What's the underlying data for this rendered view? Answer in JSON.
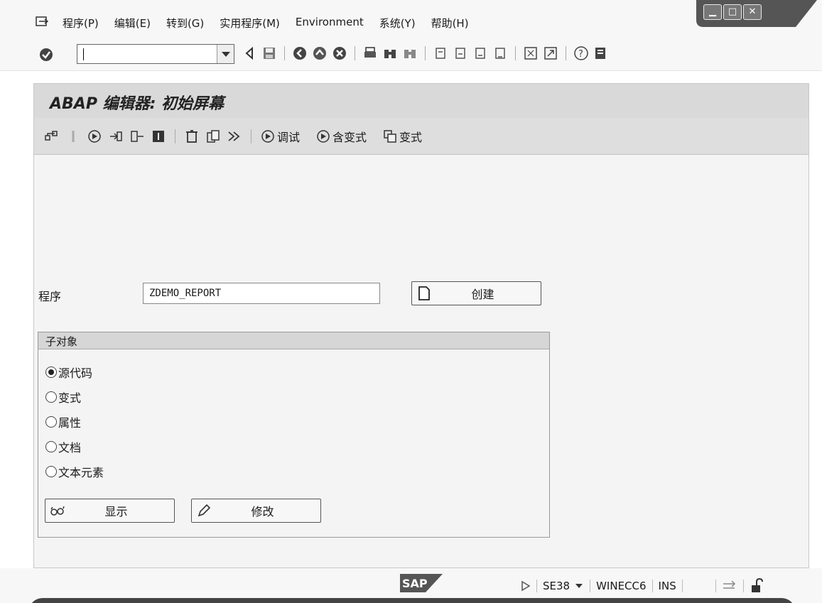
{
  "menubar": {
    "items": [
      {
        "label": "程序(P)"
      },
      {
        "label": "编辑(E)"
      },
      {
        "label": "转到(G)"
      },
      {
        "label": "实用程序(M)"
      },
      {
        "label": "Environment"
      },
      {
        "label": "系统(Y)"
      },
      {
        "label": "帮助(H)"
      }
    ]
  },
  "toolbar": {
    "command_value": ""
  },
  "screen": {
    "title": "ABAP 编辑器: 初始屏幕"
  },
  "app_toolbar": {
    "debug_label": "调试",
    "with_variant_label": "含变式",
    "variant_label": "变式"
  },
  "form": {
    "program_label": "程序",
    "program_value": "ZDEMO_REPORT",
    "create_label": "创建"
  },
  "subobjects": {
    "heading": "子对象",
    "options": [
      {
        "label": "源代码",
        "selected": true
      },
      {
        "label": "变式",
        "selected": false
      },
      {
        "label": "属性",
        "selected": false
      },
      {
        "label": "文档",
        "selected": false
      },
      {
        "label": "文本元素",
        "selected": false
      }
    ],
    "display_label": "显示",
    "change_label": "修改"
  },
  "statusbar": {
    "logo_text": "SAP",
    "transaction": "SE38",
    "system": "WINECC6",
    "mode": "INS"
  }
}
